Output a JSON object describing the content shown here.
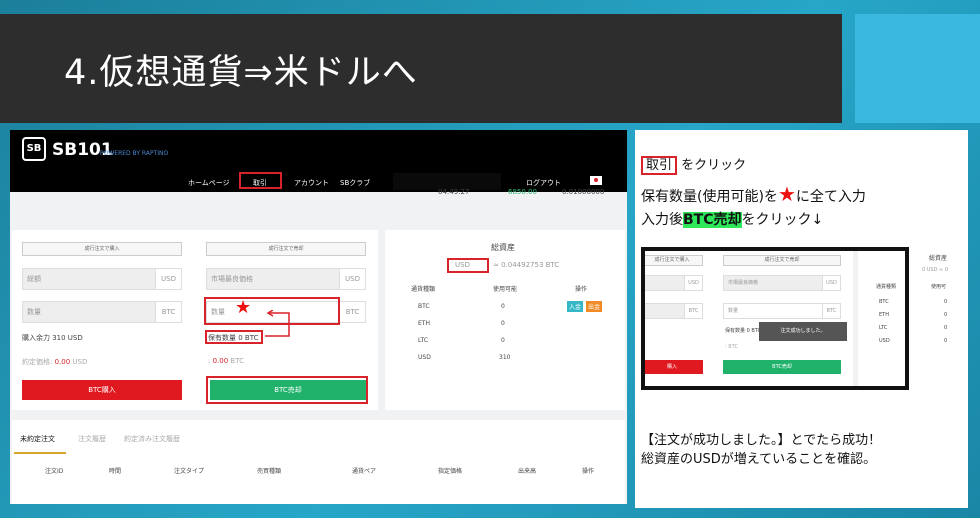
{
  "slide": {
    "title": "4.仮想通貨⇒米ドルへ"
  },
  "app": {
    "logo": "SB",
    "name": "SB101",
    "powered": "POWERED BY RAPTINO",
    "nav": [
      "ホームページ",
      "取引",
      "アカウント",
      "SBクラブ",
      "ログアウト"
    ],
    "ticker": {
      "time": "04:49:27",
      "price": "6850.00",
      "amount": "0.01000000"
    }
  },
  "buy_panel": {
    "header": "成行注文で購入",
    "amount_placeholder": "総額",
    "amount_unit": "USD",
    "qty_placeholder": "数量",
    "qty_unit": "BTC",
    "available": "購入余力 310 USD",
    "fee_label": "約定価格:",
    "fee_value": "0.00",
    "fee_unit": "USD",
    "button": "BTC購入"
  },
  "sell_panel": {
    "header": "成行注文で売却",
    "price_placeholder": "市場最良価格",
    "price_unit": "USD",
    "qty_placeholder": "数量",
    "qty_unit": "BTC",
    "star": "★",
    "holding": "保有数量 0 BTC",
    "fee_prefix": ":",
    "fee_value": "0.00",
    "fee_unit": "BTC",
    "button": "BTC売却"
  },
  "assets": {
    "title": "総資産",
    "currency": "USD",
    "total": "≈ 0.04492753 BTC",
    "headers": [
      "通貨種類",
      "使用可能",
      "操作"
    ],
    "rows": [
      {
        "currency": "BTC",
        "available": "0"
      },
      {
        "currency": "ETH",
        "available": "0"
      },
      {
        "currency": "LTC",
        "available": "0"
      },
      {
        "currency": "USD",
        "available": "310"
      }
    ],
    "deposit": "入金",
    "withdraw": "出金"
  },
  "orders": {
    "tabs": [
      "未約定注文",
      "注文履歴",
      "約定済み注文履歴"
    ],
    "columns": [
      "注文ID",
      "時間",
      "注文タイプ",
      "売買種類",
      "通貨ペア",
      "指定価格",
      "出来高",
      "操作"
    ]
  },
  "instructions": {
    "line1_box": "取引",
    "line1_rest": "をクリック",
    "line2_a": "保有数量(使用可能)を",
    "line2_star": "★",
    "line2_b": "に全て入力",
    "line3_a": "入力後",
    "line3_hl": "BTC売却",
    "line3_b": "をクリック↓",
    "footer1": "【注文が成功しました。】とでたら成功！",
    "footer2": "総資産のUSDが増えていることを確認。"
  },
  "mini": {
    "buy_header": "成行注文で購入",
    "sell_header": "成行注文で売却",
    "usd": "USD",
    "btc": "BTC",
    "market": "市場最良価格",
    "qty": "数量",
    "holding": "保有数量 0 BTC",
    "toast": "注文成功しました。",
    "btc_short": ": BTC",
    "buy_btn": "購入",
    "sell_btn": "BTC売却",
    "title": "総資産",
    "usd_total": "0 USD ≈ 0",
    "col1": "通貨種類",
    "col2": "使用可",
    "rows": [
      "BTC",
      "ETH",
      "LTC",
      "USD"
    ],
    "zero": "0"
  }
}
